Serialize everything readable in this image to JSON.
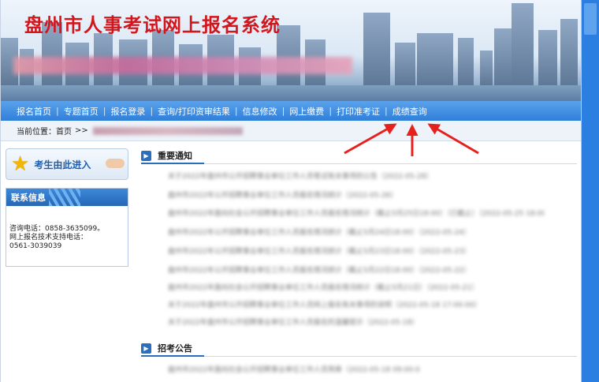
{
  "banner": {
    "title": "盘州市人事考试网上报名系统"
  },
  "nav": {
    "items": [
      "报名首页",
      "专题首页",
      "报名登录",
      "查询/打印资审结果",
      "信息修改",
      "网上缴费",
      "打印准考证",
      "成绩查询"
    ],
    "separator": "|"
  },
  "breadcrumb": {
    "prefix": "当前位置：",
    "home": "首页",
    "sep": ">>"
  },
  "left": {
    "enter_label": "考生由此进入",
    "contact": {
      "title": "联系信息",
      "lines": [
        "咨询电话：0858-3635099。",
        "网上报名技术支持电话：",
        "0561-3039039"
      ]
    }
  },
  "main": {
    "notice": {
      "title": "重要通知",
      "items": [
        "关于2022年盘州市公开招聘事业单位工作人员笔试有关事项的公告（2022-05-28）",
        "盘州市2022年公开招聘事业单位工作人员报名情况统计（2022-05-26）",
        "盘州市2022年面向社会公开招聘事业单位工作人员报名情况统计（截止5月25日18:00）（已截止）（2022-05-25 18:00:00）",
        "盘州市2022年公开招聘事业单位工作人员报名情况统计（截止5月24日18:00）（2022-05-24）",
        "盘州市2022年公开招聘事业单位工作人员报名情况统计（截止5月23日18:00）（2022-05-23）",
        "盘州市2022年公开招聘事业单位工作人员报名情况统计（截止5月22日18:00）（2022-05-22）",
        "盘州市2022年面向社会公开招聘事业单位工作人员报名情况统计（截止5月21日）（2022-05-21）",
        "关于2022年盘州市公开招聘事业单位工作人员网上报名有关事项的说明（2022-05-18 17:00:00）",
        "关于2022年盘州市公开招聘事业单位工作人员报名的温馨提示（2022-05-18）"
      ]
    },
    "recruit": {
      "title": "招考公告",
      "items": [
        "盘州市2022年面向社会公开招聘事业单位工作人员简章（2022-05-18 09:00:00）"
      ]
    }
  },
  "colors": {
    "nav": "#3a8ae0",
    "title": "#d2161c",
    "annotation_arrow": "#e8201c"
  }
}
